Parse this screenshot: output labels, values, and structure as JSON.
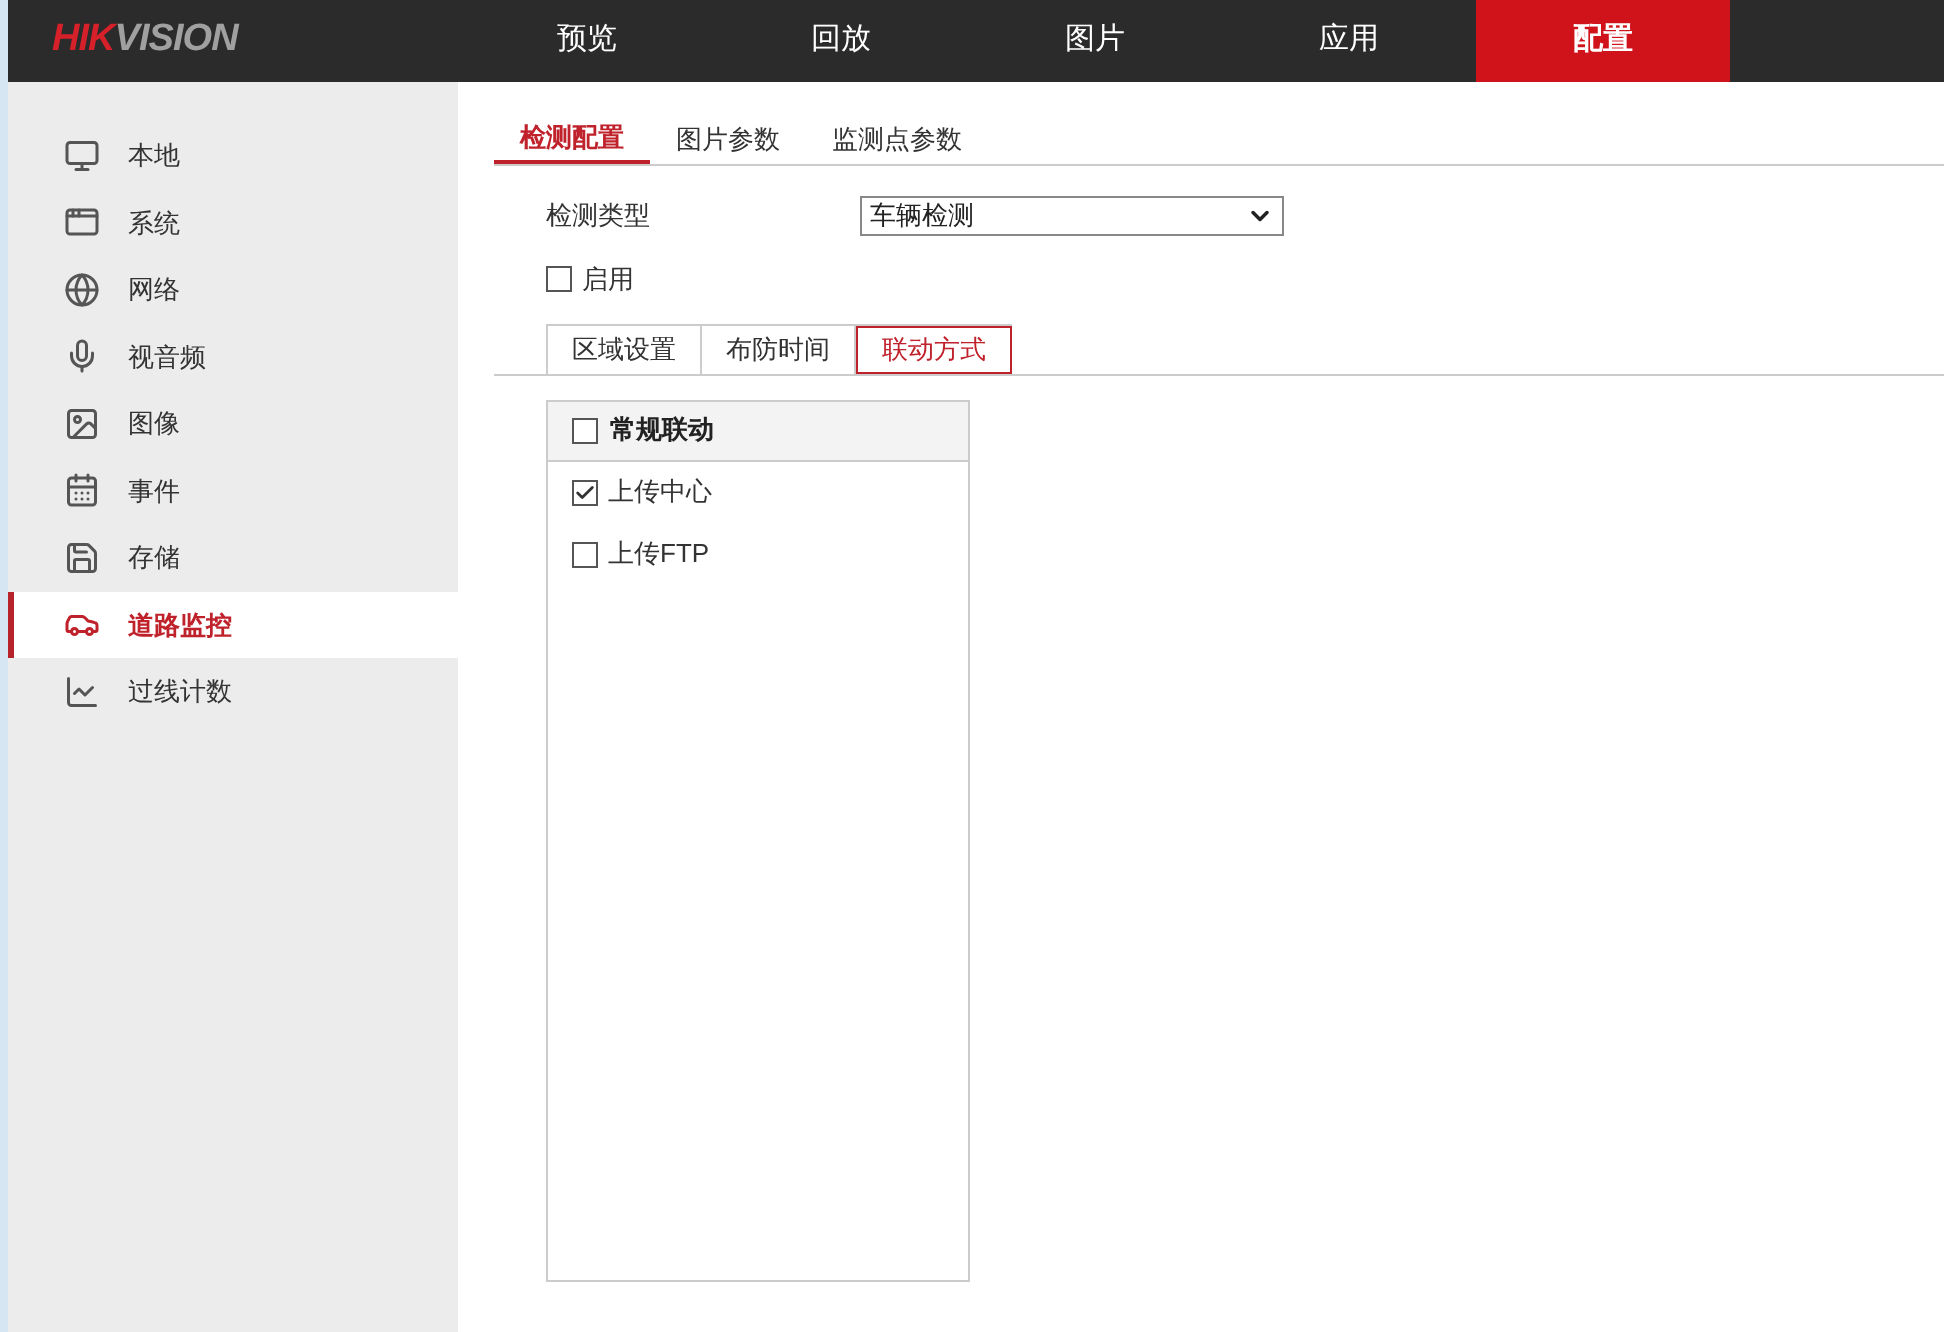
{
  "logo": {
    "brand": "HIK",
    "suffix": "VISION"
  },
  "nav": [
    {
      "label": "预览",
      "selected": false
    },
    {
      "label": "回放",
      "selected": false
    },
    {
      "label": "图片",
      "selected": false
    },
    {
      "label": "应用",
      "selected": false
    },
    {
      "label": "配置",
      "selected": true
    }
  ],
  "sidebar": {
    "items": [
      {
        "label": "本地",
        "selected": false
      },
      {
        "label": "系统",
        "selected": false
      },
      {
        "label": "网络",
        "selected": false
      },
      {
        "label": "视音频",
        "selected": false
      },
      {
        "label": "图像",
        "selected": false
      },
      {
        "label": "事件",
        "selected": false
      },
      {
        "label": "存储",
        "selected": false
      },
      {
        "label": "道路监控",
        "selected": true
      },
      {
        "label": "过线计数",
        "selected": false
      }
    ]
  },
  "tabs": [
    {
      "label": "检测配置",
      "selected": true
    },
    {
      "label": "图片参数",
      "selected": false
    },
    {
      "label": "监测点参数",
      "selected": false
    }
  ],
  "detection_type": {
    "label": "检测类型",
    "value": "车辆检测"
  },
  "enable": {
    "label": "启用",
    "checked": false
  },
  "steps": [
    {
      "label": "区域设置",
      "selected": false
    },
    {
      "label": "布防时间",
      "selected": false
    },
    {
      "label": "联动方式",
      "selected": true
    }
  ],
  "linkage": {
    "header": {
      "label": "常规联动",
      "checked": false
    },
    "items": [
      {
        "label": "上传中心",
        "checked": true
      },
      {
        "label": "上传FTP",
        "checked": false
      }
    ]
  }
}
